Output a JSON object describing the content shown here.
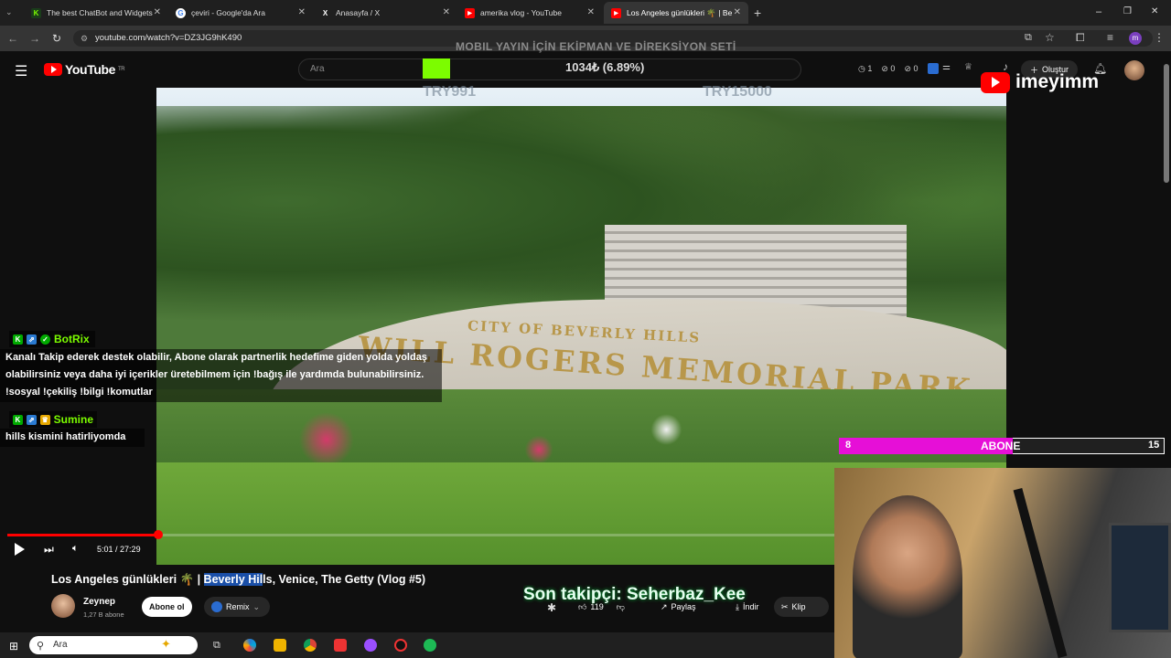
{
  "browser": {
    "tabs": [
      {
        "title": "The best ChatBot and Widgets",
        "favicon": "K"
      },
      {
        "title": "çeviri - Google'da Ara",
        "favicon": "G"
      },
      {
        "title": "Anasayfa / X",
        "favicon": "X"
      },
      {
        "title": "amerika vlog - YouTube",
        "favicon": "▶"
      },
      {
        "title": "Los Angeles günlükleri 🌴 | Be",
        "favicon": "▶"
      }
    ],
    "url": "youtube.com/watch?v=DZ3JG9hK490",
    "window_controls": [
      "–",
      "❐",
      "✕"
    ]
  },
  "youtube": {
    "logo_text": "YouTube",
    "region": "TR",
    "search_placeholder": "Ara",
    "create_label": "Oluştur",
    "header_counters": [
      "1",
      "0",
      "0"
    ]
  },
  "stream_overlay": {
    "banner_text": "MOBIL YAYIN İÇİN EKİPMAN VE DİREKSİYON SETİ",
    "donation_progress_text": "1034₺ (6.89%)",
    "goal_left": "TRY991",
    "goal_right": "TRY15000",
    "channel_handle": "imeyimm",
    "abone_label": "ABONE",
    "abone_current": "8",
    "abone_goal": "15",
    "abone_fraction": 0.533,
    "son_takipci": "Son takipçi: Seherbaz_Kee",
    "chat": [
      {
        "user": "BotRix",
        "user_color": "#7cfc00",
        "message": "Kanalı Takip ederek destek olabilir, Abone olarak partnerlik hedefime giden yolda yoldaş olabilirsiniz veya daha iyi içerikler üretebilmem için !bağış ile yardımda bulunabilirsiniz. !sosyal !çekiliş !bilgi !komutlar"
      },
      {
        "user": "Sumine",
        "user_color": "#7cfc00",
        "message": "hills kismini hatirliyomda"
      }
    ]
  },
  "video": {
    "sign_line1": "CITY OF BEVERLY HILLS",
    "sign_line2": "WILL ROGERS MEMORIAL PARK",
    "time_current": "5:01",
    "time_total": "27:29",
    "progress": 0.182,
    "title_before": "Los Angeles günlükleri 🌴 | ",
    "title_highlight": "Beverly Hil",
    "title_after": "ls, Venice, The Getty (Vlog #5)"
  },
  "channel": {
    "name": "Zeynep",
    "subscribers": "1,27 B abone",
    "subscribe_label": "Abone ol",
    "remix_label": "Remix"
  },
  "actions": {
    "likes": "119",
    "share": "Paylaş",
    "download": "İndir",
    "clip": "Klip"
  },
  "taskbar": {
    "search_placeholder": "Ara"
  }
}
